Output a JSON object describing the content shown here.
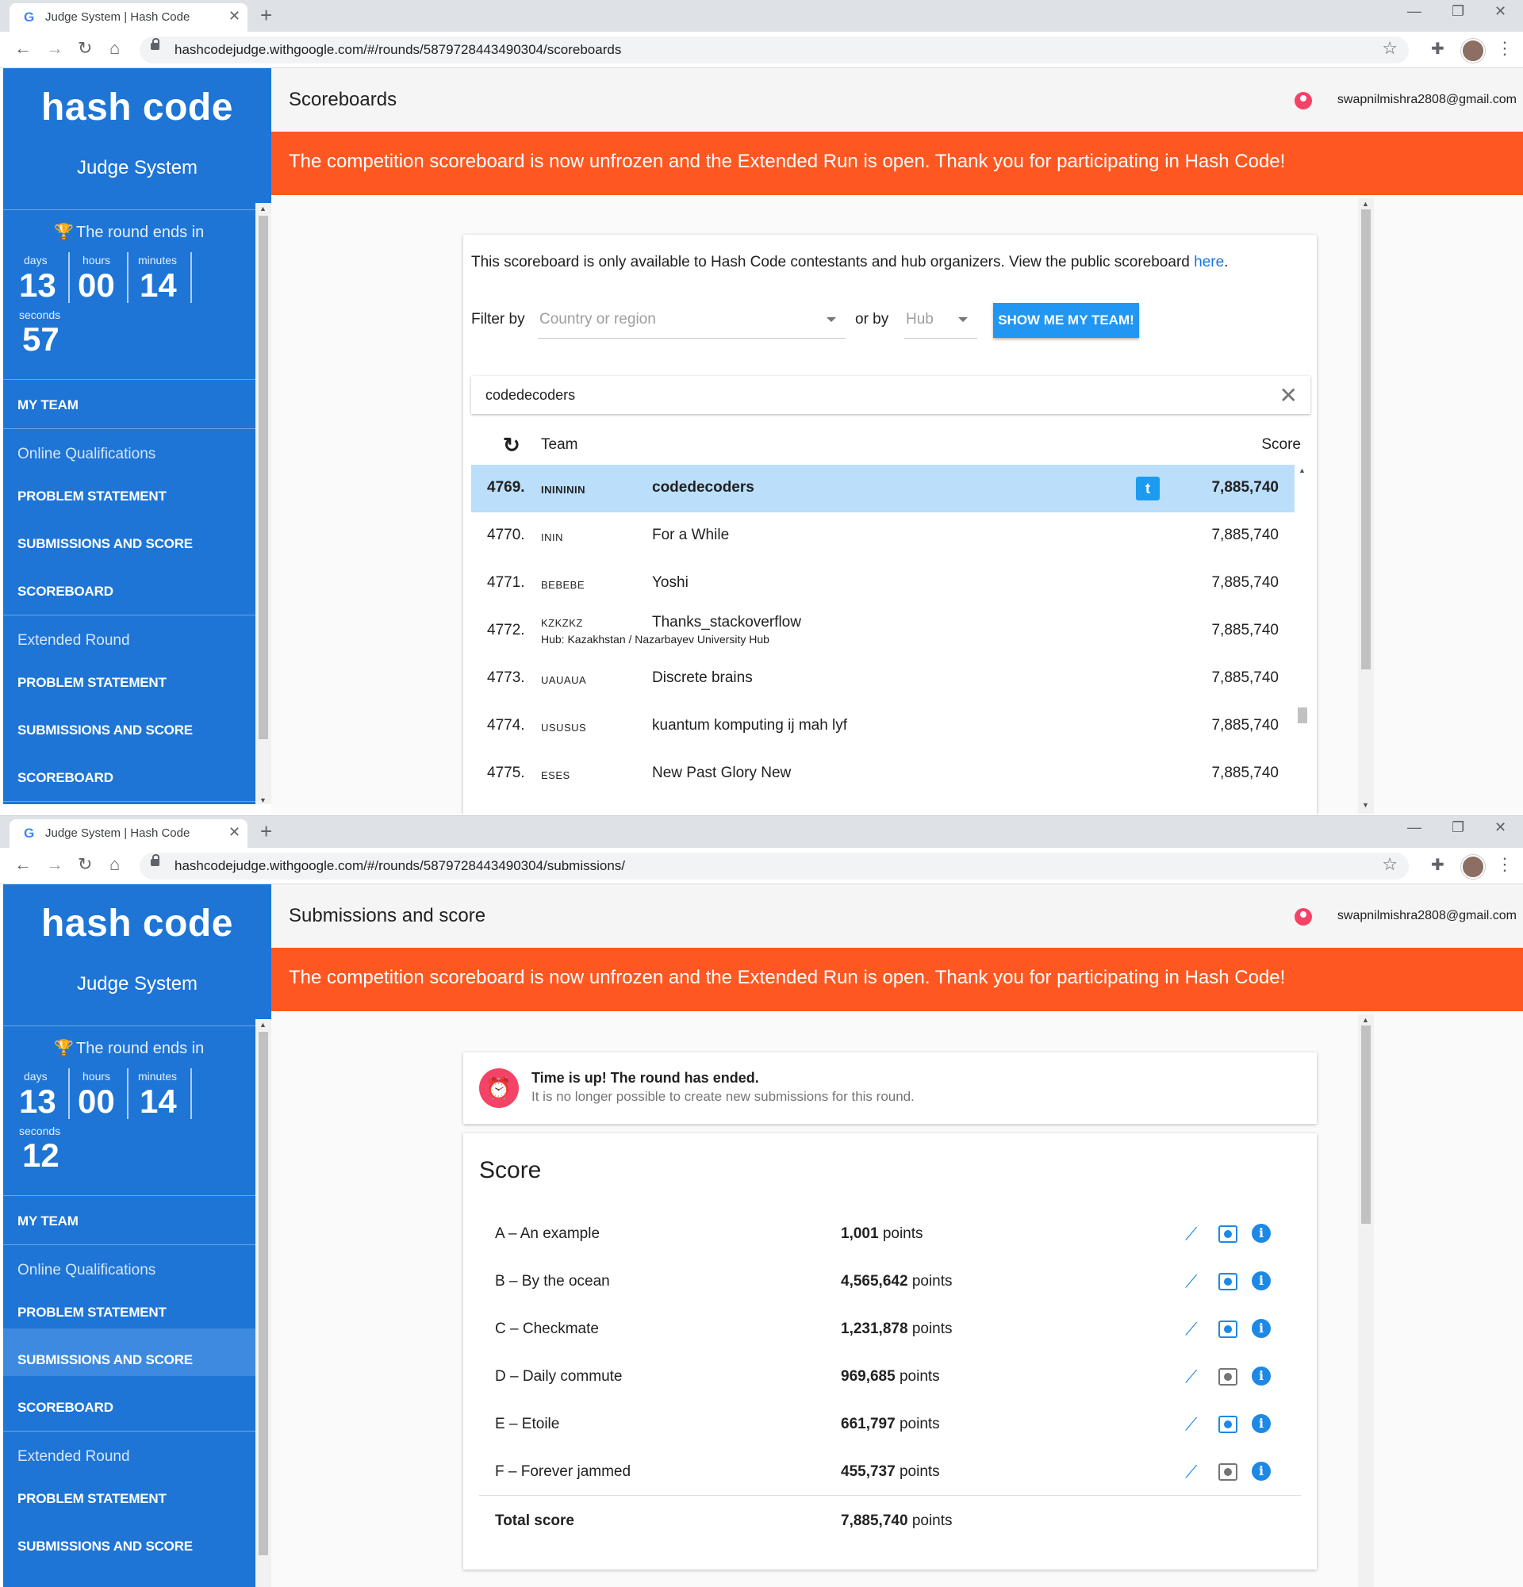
{
  "windows": [
    {
      "tab_title": "Judge System | Hash Code",
      "url": "hashcodejudge.withgoogle.com/#/rounds/5879728443490304/scoreboards",
      "sidebar": {
        "logo": "hash code",
        "subtitle": "Judge System",
        "timer": {
          "title": "The round ends in",
          "days_label": "days",
          "hours_label": "hours",
          "minutes_label": "minutes",
          "seconds_label": "seconds",
          "days": "13",
          "hours": "00",
          "minutes": "14",
          "seconds": "57"
        },
        "my_team": "MY TEAM",
        "online_head": "Online Qualifications",
        "online_items": [
          "PROBLEM STATEMENT",
          "SUBMISSIONS AND SCORE",
          "SCOREBOARD"
        ],
        "extended_head": "Extended Round",
        "extended_items": [
          "PROBLEM STATEMENT",
          "SUBMISSIONS AND SCORE",
          "SCOREBOARD"
        ]
      },
      "header_title": "Scoreboards",
      "user": "swapnilmishra2808@gmail.com",
      "banner": "The competition scoreboard is now unfrozen and the Extended Run is open. Thank you for participating in Hash Code!",
      "scoreboard": {
        "note": "This scoreboard is only available to Hash Code contestants and hub organizers. View the public scoreboard ",
        "note_link": "here",
        "note_end": ".",
        "filter_by": "Filter by",
        "country_placeholder": "Country or region",
        "or_by": "or by",
        "hub_placeholder": "Hub",
        "show_team_button": "SHOW ME MY TEAM!",
        "search_value": "codedecoders",
        "col_team": "Team",
        "col_score": "Score",
        "rows": [
          {
            "rank": "4769.",
            "code": "ININININ",
            "name": "codedecoders",
            "score": "7,885,740",
            "hub": ""
          },
          {
            "rank": "4770.",
            "code": "ININ",
            "name": "For a While",
            "score": "7,885,740",
            "hub": ""
          },
          {
            "rank": "4771.",
            "code": "BEBEBE",
            "name": "Yoshi",
            "score": "7,885,740",
            "hub": ""
          },
          {
            "rank": "4772.",
            "code": "KZKZKZ",
            "name": "Thanks_stackoverflow",
            "score": "7,885,740",
            "hub": "Hub: Kazakhstan / Nazarbayev University Hub"
          },
          {
            "rank": "4773.",
            "code": "UAUAUA",
            "name": "Discrete brains",
            "score": "7,885,740",
            "hub": ""
          },
          {
            "rank": "4774.",
            "code": "USUSUS",
            "name": "kuantum komputing ij mah lyf",
            "score": "7,885,740",
            "hub": ""
          },
          {
            "rank": "4775.",
            "code": "ESES",
            "name": "New Past Glory New",
            "score": "7,885,740",
            "hub": ""
          }
        ]
      }
    },
    {
      "tab_title": "Judge System | Hash Code",
      "url": "hashcodejudge.withgoogle.com/#/rounds/5879728443490304/submissions/",
      "sidebar": {
        "logo": "hash code",
        "subtitle": "Judge System",
        "timer": {
          "title": "The round ends in",
          "days_label": "days",
          "hours_label": "hours",
          "minutes_label": "minutes",
          "seconds_label": "seconds",
          "days": "13",
          "hours": "00",
          "minutes": "14",
          "seconds": "12"
        },
        "my_team": "MY TEAM",
        "online_head": "Online Qualifications",
        "online_items": [
          "PROBLEM STATEMENT",
          "SUBMISSIONS AND SCORE",
          "SCOREBOARD"
        ],
        "extended_head": "Extended Round",
        "extended_items": [
          "PROBLEM STATEMENT",
          "SUBMISSIONS AND SCORE"
        ]
      },
      "header_title": "Submissions and score",
      "user": "swapnilmishra2808@gmail.com",
      "banner": "The competition scoreboard is now unfrozen and the Extended Run is open. Thank you for participating in Hash Code!",
      "time_up": {
        "title": "Time is up! The round has ended.",
        "subtitle": "It is no longer possible to create new submissions for this round."
      },
      "score": {
        "heading": "Score",
        "points_word": "points",
        "rows": [
          {
            "name": "A – An example",
            "points": "1,001",
            "view_active": true
          },
          {
            "name": "B – By the ocean",
            "points": "4,565,642",
            "view_active": true
          },
          {
            "name": "C – Checkmate",
            "points": "1,231,878",
            "view_active": true
          },
          {
            "name": "D – Daily commute",
            "points": "969,685",
            "view_active": false
          },
          {
            "name": "E – Etoile",
            "points": "661,797",
            "view_active": true
          },
          {
            "name": "F – Forever jammed",
            "points": "455,737",
            "view_active": false
          }
        ],
        "total_label": "Total score",
        "total_points": "7,885,740"
      }
    }
  ],
  "colors": {
    "sidebar": "#1e75d6",
    "banner": "#ff5722",
    "highlight_row": "#bbdefb",
    "accent": "#2196f3"
  },
  "icons": [
    "google-g-icon",
    "close-icon",
    "plus-icon",
    "back-icon",
    "forward-icon",
    "reload-icon",
    "home-icon",
    "lock-icon",
    "star-icon",
    "puzzle-icon",
    "profile-avatar-icon",
    "kebab-icon",
    "trophy-icon",
    "user-icon",
    "dropdown-caret-icon",
    "clear-icon",
    "refresh-icon",
    "twitter-icon",
    "alarm-off-icon",
    "chart-icon",
    "view-icon",
    "info-icon"
  ]
}
